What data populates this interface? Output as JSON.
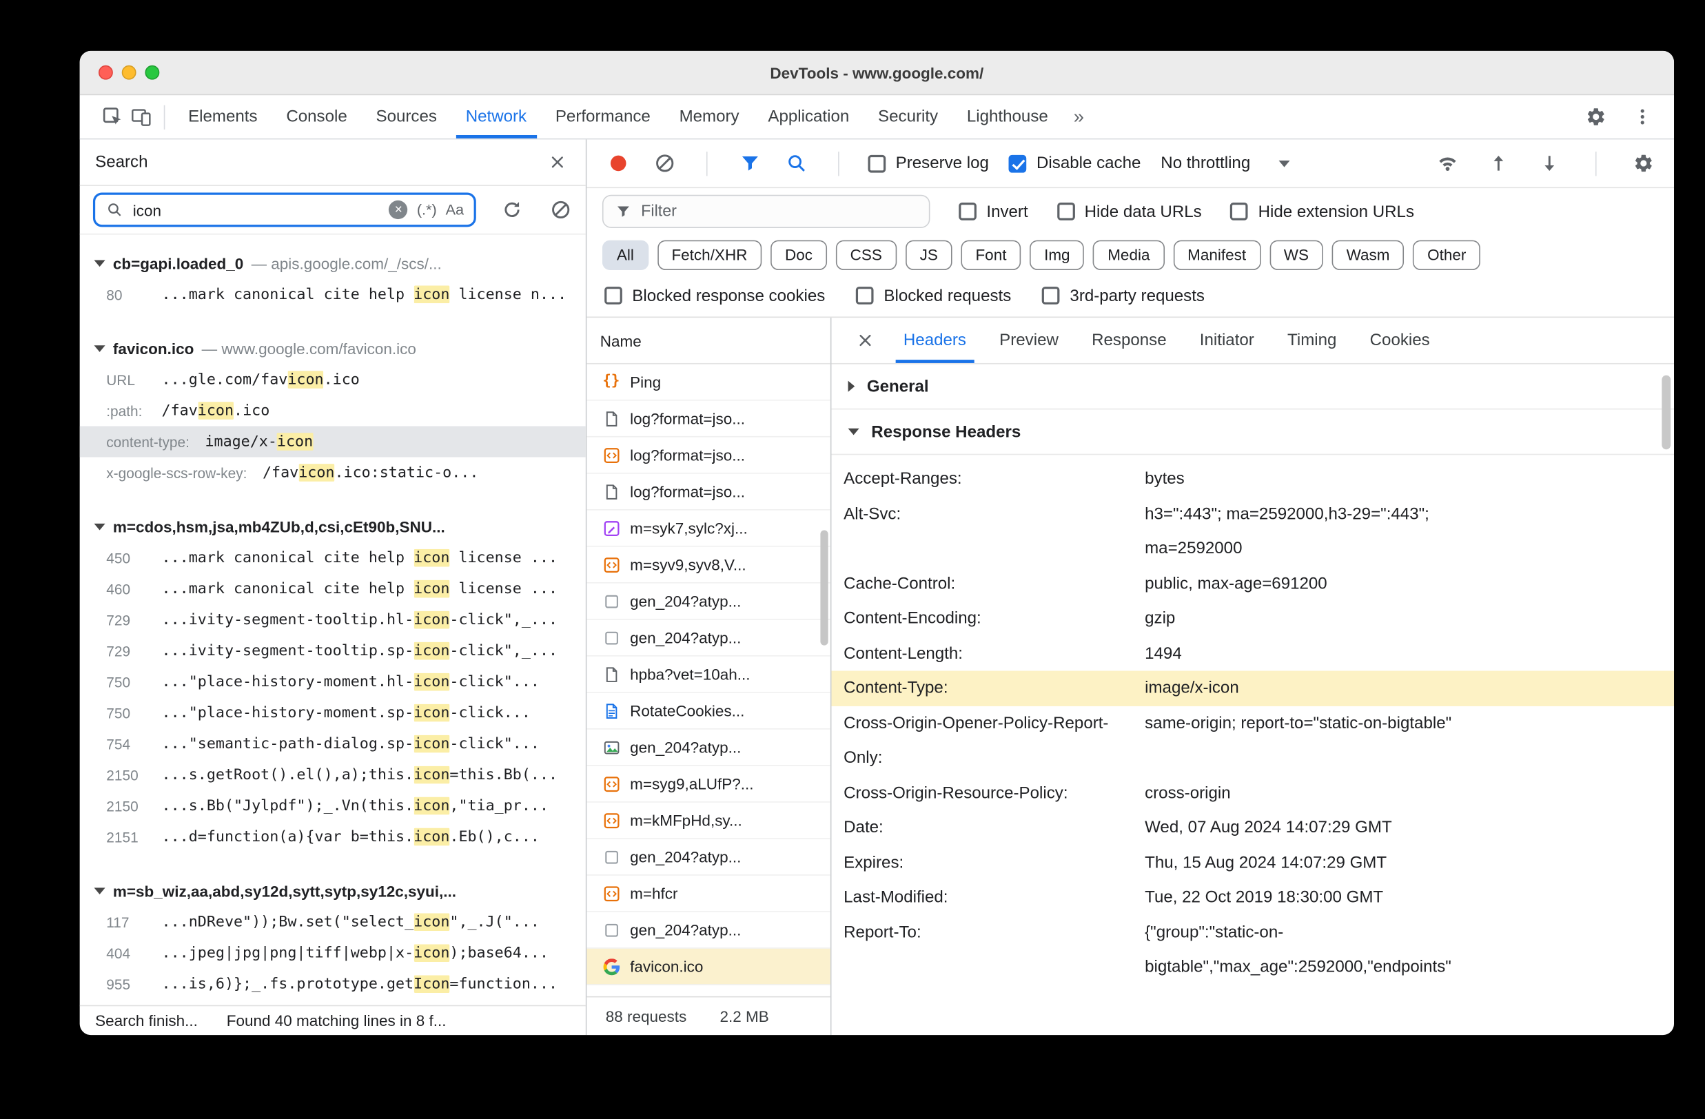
{
  "colors": {
    "accent": "#1a73e8",
    "match_highlight": "#fbeea6",
    "selected_result_bg": "#e4e6e9",
    "selected_request_bg": "#fbf1ce",
    "header_highlight_bg": "#fdf2c5",
    "chip_active_bg": "#dbe1ea",
    "record_red": "#e8442d"
  },
  "titlebar": {
    "title": "DevTools - www.google.com/"
  },
  "toolbar": {
    "tabs": [
      "Elements",
      "Console",
      "Sources",
      "Network",
      "Performance",
      "Memory",
      "Application",
      "Security",
      "Lighthouse"
    ],
    "active_tab": "Network",
    "more_symbol": "»"
  },
  "search": {
    "panel_title": "Search",
    "query": "icon",
    "clear_glyph": "×",
    "regex_toggle": "(.*)",
    "case_toggle": "Aa",
    "url_separator": "—",
    "results": [
      {
        "file": "cb=gapi.loaded_0",
        "url": "apis.google.com/_/scs/...",
        "matches": [
          {
            "label": "80",
            "pre": "...mark canonical cite help ",
            "match": "icon",
            "post": " license n..."
          }
        ]
      },
      {
        "file": "favicon.ico",
        "url": "www.google.com/favicon.ico",
        "matches": [
          {
            "label": "URL",
            "pre": "...gle.com/fav",
            "match": "icon",
            "post": ".ico"
          },
          {
            "label": ":path:",
            "pre": "/fav",
            "match": "icon",
            "post": ".ico"
          },
          {
            "label": "content-type:",
            "pre": "image/x-",
            "match": "icon",
            "post": "",
            "selected": true
          },
          {
            "label": "x-google-scs-row-key:",
            "pre": "/fav",
            "match": "icon",
            "post": ".ico:static-o..."
          }
        ]
      },
      {
        "file": "m=cdos,hsm,jsa,mb4ZUb,d,csi,cEt90b,SNU...",
        "url": "",
        "matches": [
          {
            "label": "450",
            "pre": "...mark canonical cite help ",
            "match": "icon",
            "post": " license ..."
          },
          {
            "label": "460",
            "pre": "...mark canonical cite help ",
            "match": "icon",
            "post": " license ..."
          },
          {
            "label": "729",
            "pre": "...ivity-segment-tooltip.hl-",
            "match": "icon",
            "post": "-click\",_..."
          },
          {
            "label": "729",
            "pre": "...ivity-segment-tooltip.sp-",
            "match": "icon",
            "post": "-click\",_..."
          },
          {
            "label": "750",
            "pre": "...\"place-history-moment.hl-",
            "match": "icon",
            "post": "-click\"..."
          },
          {
            "label": "750",
            "pre": "...\"place-history-moment.sp-",
            "match": "icon",
            "post": "-click..."
          },
          {
            "label": "754",
            "pre": "...\"semantic-path-dialog.sp-",
            "match": "icon",
            "post": "-click\"..."
          },
          {
            "label": "2150",
            "pre": "...s.getRoot().el(),a);this.",
            "match": "icon",
            "post": "=this.Bb(..."
          },
          {
            "label": "2150",
            "pre": "...s.Bb(\"Jylpdf\");_.Vn(this.",
            "match": "icon",
            "post": ",\"tia_pr..."
          },
          {
            "label": "2151",
            "pre": "...d=function(a){var b=this.",
            "match": "icon",
            "post": ".Eb(),c..."
          }
        ]
      },
      {
        "file": "m=sb_wiz,aa,abd,sy12d,sytt,sytp,sy12c,syui,...",
        "url": "",
        "matches": [
          {
            "label": "117",
            "pre": "...nDReve\"));Bw.set(\"select_",
            "match": "icon",
            "post": "\",_.J(\"..."
          },
          {
            "label": "404",
            "pre": "...jpeg|jpg|png|tiff|webp|x-",
            "match": "icon",
            "post": ");base64..."
          },
          {
            "label": "955",
            "pre": "...is,6)};_.fs.prototype.get",
            "match": "Icon",
            "post": "=function..."
          }
        ]
      }
    ],
    "footer": {
      "left": "Search finish...",
      "right": "Found 40 matching lines in 8 f..."
    }
  },
  "network": {
    "toolbar": {
      "preserve_log": "Preserve log",
      "disable_cache": "Disable cache",
      "throttling": "No throttling"
    },
    "filter": {
      "placeholder": "Filter",
      "invert": "Invert",
      "hide_data_urls": "Hide data URLs",
      "hide_extension_urls": "Hide extension URLs"
    },
    "chips": [
      "All",
      "Fetch/XHR",
      "Doc",
      "CSS",
      "JS",
      "Font",
      "Img",
      "Media",
      "Manifest",
      "WS",
      "Wasm",
      "Other"
    ],
    "active_chip": "All",
    "blocked_options": [
      "Blocked response cookies",
      "Blocked requests",
      "3rd-party requests"
    ],
    "table": {
      "name_header": "Name",
      "rows": [
        {
          "name": "Ping",
          "icon": "json"
        },
        {
          "name": "log?format=jso...",
          "icon": "doc"
        },
        {
          "name": "log?format=jso...",
          "icon": "script"
        },
        {
          "name": "log?format=jso...",
          "icon": "doc"
        },
        {
          "name": "m=syk7,sylc?xj...",
          "icon": "css"
        },
        {
          "name": "m=syv9,syv8,V...",
          "icon": "script"
        },
        {
          "name": "gen_204?atyp...",
          "icon": "blank"
        },
        {
          "name": "gen_204?atyp...",
          "icon": "blank"
        },
        {
          "name": "hpba?vet=10ah...",
          "icon": "doc"
        },
        {
          "name": "RotateCookies...",
          "icon": "bluedoc"
        },
        {
          "name": "gen_204?atyp...",
          "icon": "image"
        },
        {
          "name": "m=syg9,aLUfP?...",
          "icon": "script"
        },
        {
          "name": "m=kMFpHd,sy...",
          "icon": "script"
        },
        {
          "name": "gen_204?atyp...",
          "icon": "blank"
        },
        {
          "name": "m=hfcr",
          "icon": "script"
        },
        {
          "name": "gen_204?atyp...",
          "icon": "blank"
        },
        {
          "name": "favicon.ico",
          "icon": "favicon",
          "selected": true
        }
      ]
    },
    "summary": {
      "requests": "88 requests",
      "size": "2.2 MB"
    }
  },
  "details": {
    "tabs": [
      "Headers",
      "Preview",
      "Response",
      "Initiator",
      "Timing",
      "Cookies"
    ],
    "active_tab": "Headers",
    "sections": [
      {
        "label": "General",
        "expanded": false
      },
      {
        "label": "Response Headers",
        "expanded": true,
        "key": "response_headers"
      }
    ],
    "response_headers": [
      {
        "name": "Accept-Ranges:",
        "value": "bytes"
      },
      {
        "name": "Alt-Svc:",
        "value": "h3=\":443\"; ma=2592000,h3-29=\":443\"; ma=2592000"
      },
      {
        "name": "Cache-Control:",
        "value": "public, max-age=691200"
      },
      {
        "name": "Content-Encoding:",
        "value": "gzip"
      },
      {
        "name": "Content-Length:",
        "value": "1494"
      },
      {
        "name": "Content-Type:",
        "value": "image/x-icon",
        "highlighted": true
      },
      {
        "name": "Cross-Origin-Opener-Policy-Report-Only:",
        "value": "same-origin; report-to=\"static-on-bigtable\""
      },
      {
        "name": "Cross-Origin-Resource-Policy:",
        "value": "cross-origin"
      },
      {
        "name": "Date:",
        "value": "Wed, 07 Aug 2024 14:07:29 GMT"
      },
      {
        "name": "Expires:",
        "value": "Thu, 15 Aug 2024 14:07:29 GMT"
      },
      {
        "name": "Last-Modified:",
        "value": "Tue, 22 Oct 2019 18:30:00 GMT"
      },
      {
        "name": "Report-To:",
        "value": "{\"group\":\"static-on-bigtable\",\"max_age\":2592000,\"endpoints\""
      }
    ]
  }
}
